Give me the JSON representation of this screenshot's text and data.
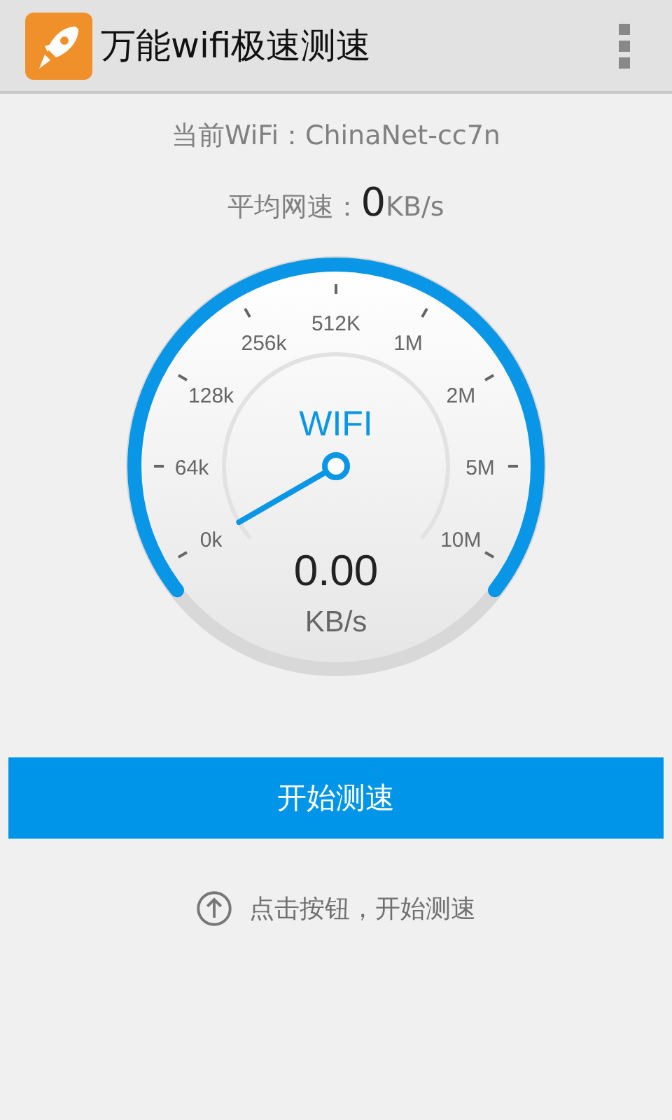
{
  "app_bar": {
    "title": "万能wifi极速测速"
  },
  "wifi": {
    "label": "当前WiFi：",
    "name": "ChinaNet-cc7n"
  },
  "average": {
    "label": "平均网速：",
    "value": "0",
    "unit": "KB/s"
  },
  "gauge": {
    "scale": [
      "0k",
      "64k",
      "128k",
      "256k",
      "512K",
      "1M",
      "2M",
      "5M",
      "10M"
    ],
    "title": "WIFI",
    "reading": "0.00",
    "unit": "KB/s"
  },
  "start_button": {
    "label": "开始测速"
  },
  "hint": {
    "text": "点击按钮，开始测速"
  }
}
